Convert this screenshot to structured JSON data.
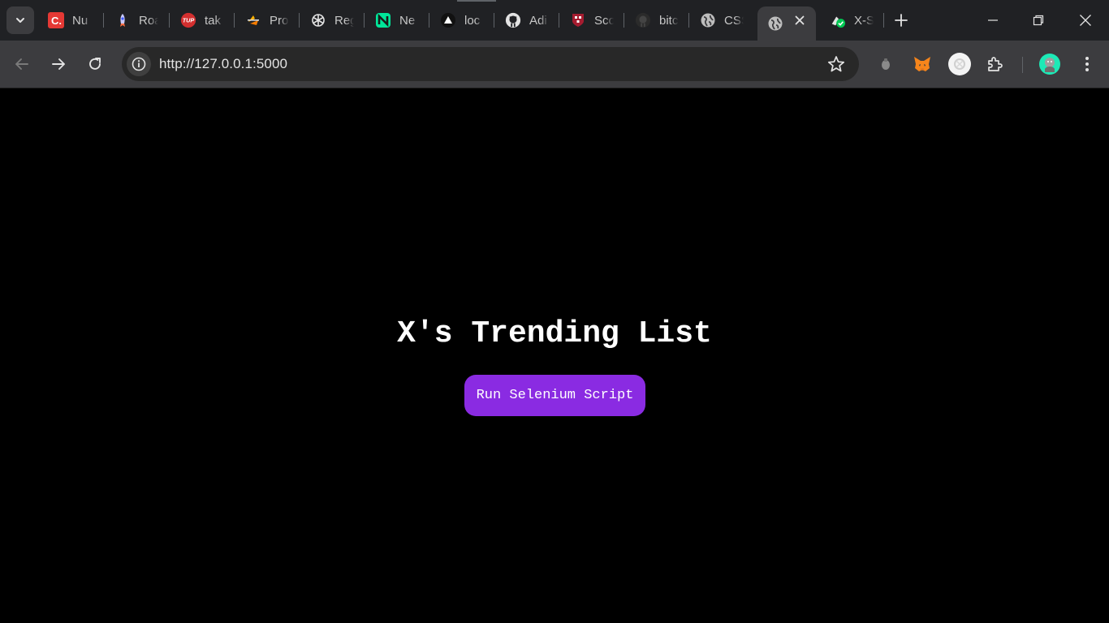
{
  "browser": {
    "tabs": [
      {
        "title": "Nu",
        "icon": "coursera-icon"
      },
      {
        "title": "Roa",
        "icon": "rocket-icon"
      },
      {
        "title": "tak",
        "icon": "tup-icon"
      },
      {
        "title": "Pro",
        "icon": "project-icon"
      },
      {
        "title": "Reg",
        "icon": "openai-icon"
      },
      {
        "title": "Ne",
        "icon": "neon-icon"
      },
      {
        "title": "loc",
        "icon": "triangle-icon"
      },
      {
        "title": "Adi",
        "icon": "github-icon"
      },
      {
        "title": "Sco",
        "icon": "harvard-icon"
      },
      {
        "title": "bitc",
        "icon": "github-icon"
      },
      {
        "title": "CSS",
        "icon": "globe-icon"
      }
    ],
    "active_tab": {
      "title": "",
      "icon": "globe-icon"
    },
    "last_tab": {
      "title": "X-S",
      "icon": "x-scraper-icon"
    },
    "url": "http://127.0.0.1:5000",
    "extensions": [
      "extension-dot-icon",
      "metamask-icon",
      "profile-circle-icon",
      "puzzle-icon"
    ],
    "profile_icon": "user-avatar-icon"
  },
  "page": {
    "title": "X's Trending List",
    "run_button_label": "Run Selenium Script"
  },
  "colors": {
    "tab_strip": "#202124",
    "toolbar": "#3c3c3f",
    "page_background": "#000000",
    "button_background": "#8a2be2",
    "text": "#ffffff"
  }
}
